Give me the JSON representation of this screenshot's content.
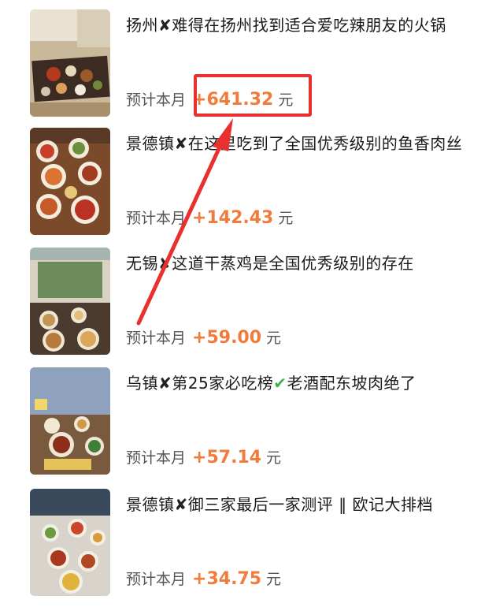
{
  "feed": {
    "items": [
      {
        "title_pre": "扬州",
        "separator": "✘",
        "title_post": "难得在扬州找到适合爱吃辣朋友的火锅",
        "earn_label": "预计本月",
        "amount": "+641.32",
        "unit": "元"
      },
      {
        "title_pre": "景德镇",
        "separator": "✘",
        "title_post": "在这里吃到了全国优秀级别的鱼香肉丝",
        "earn_label": "预计本月",
        "amount": "+142.43",
        "unit": "元"
      },
      {
        "title_pre": "无锡",
        "separator": "✘",
        "title_post": "这道干蒸鸡是全国优秀级别的存在",
        "earn_label": "预计本月",
        "amount": "+59.00",
        "unit": "元"
      },
      {
        "title_pre": "乌镇",
        "separator": "✘",
        "title_mid": "第25家必吃榜",
        "check": "✔",
        "title_post": "老酒配东坡肉绝了",
        "earn_label": "预计本月",
        "amount": "+57.14",
        "unit": "元"
      },
      {
        "title_pre": "景德镇",
        "separator": "✘",
        "title_post": "御三家最后一家测评 ‖ 欧记大排档",
        "earn_label": "预计本月",
        "amount": "+34.75",
        "unit": "元"
      }
    ]
  },
  "colors": {
    "amount": "#f07b3a",
    "highlight": "#e8302f",
    "check": "#3db24b"
  },
  "icons": [
    "cross-mark-icon",
    "check-mark-icon",
    "annotation-arrow"
  ]
}
